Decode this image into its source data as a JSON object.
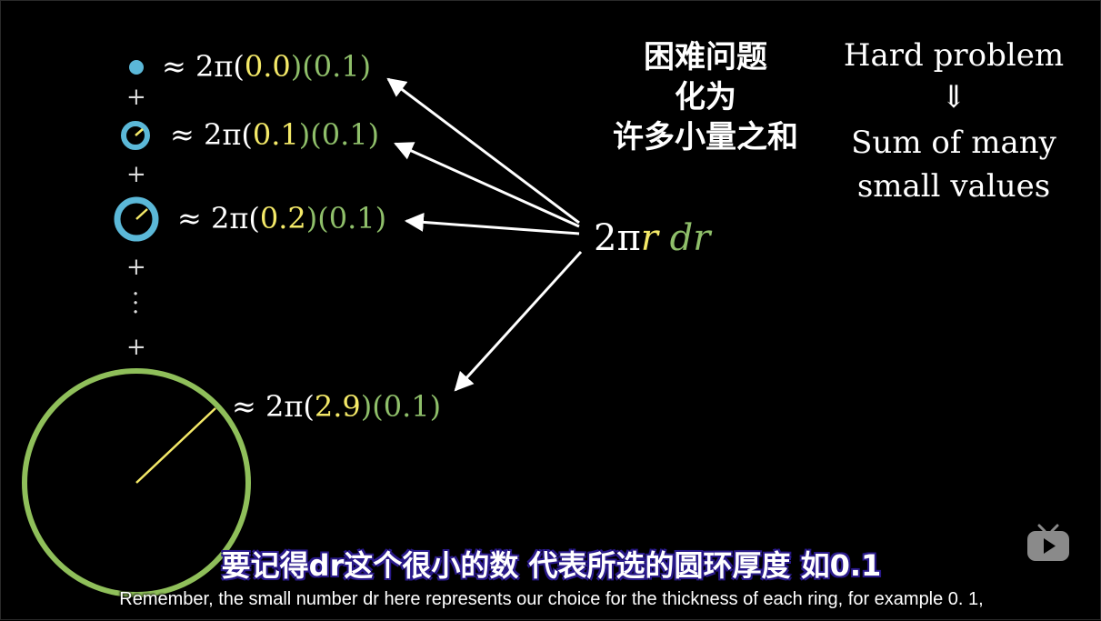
{
  "terms": [
    {
      "approx": "≈ 2π(",
      "r": "0.0",
      "mid": ")(",
      "dr": "0.1",
      "end": ")"
    },
    {
      "approx": "≈ 2π(",
      "r": "0.1",
      "mid": ")(",
      "dr": "0.1",
      "end": ")"
    },
    {
      "approx": "≈ 2π(",
      "r": "0.2",
      "mid": ")(",
      "dr": "0.1",
      "end": ")"
    },
    {
      "approx": "≈ 2π(",
      "r": "2.9",
      "mid": ")(",
      "dr": "0.1",
      "end": ")"
    }
  ],
  "plus_symbol": "+",
  "zh_title": {
    "line1": "困难问题",
    "line2": "化为",
    "line3": "许多小量之和"
  },
  "en_title": {
    "line1": "Hard problem",
    "arrow": "⇓",
    "line2": "Sum of many",
    "line3": "small values"
  },
  "expression": {
    "coef": "2π",
    "r": "r",
    "dr": "dr"
  },
  "subtitles": {
    "zh": "要记得dr这个很小的数  代表所选的圆环厚度  如0.1",
    "en": "Remember, the small number dr here represents our choice for the thickness of each ring, for example 0. 1,"
  },
  "colors": {
    "ring_blue": "#5bb8d8",
    "ring_green": "#8fbf5a",
    "radius_yellow": "#f4e968",
    "subtitle_outline": "#2a1a8a"
  },
  "logo_icon": "tv-play-icon"
}
